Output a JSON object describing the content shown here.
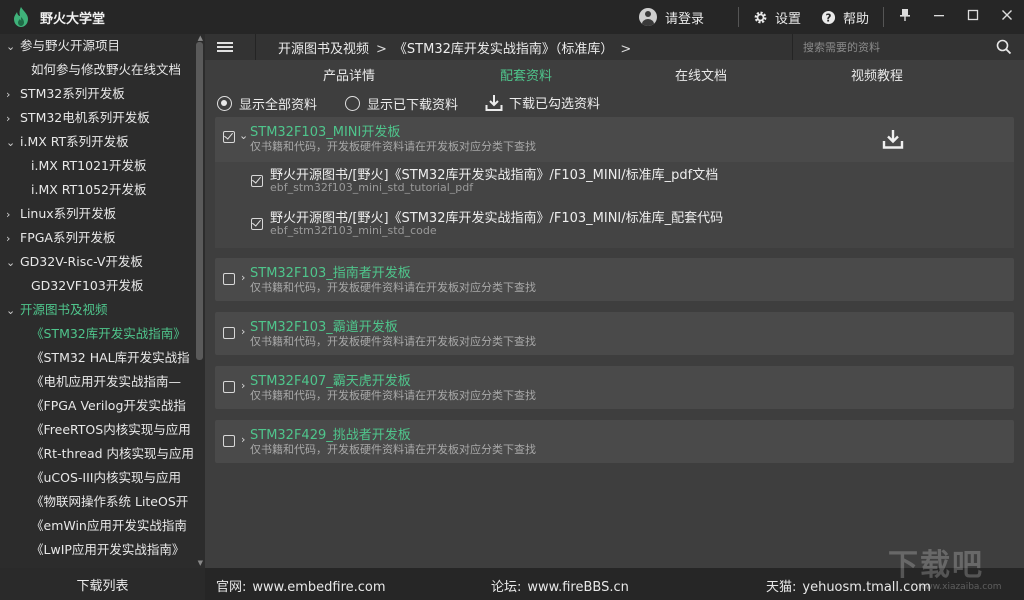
{
  "app": {
    "title": "野火大学堂",
    "login_label": "请登录",
    "settings_label": "设置",
    "help_label": "帮助"
  },
  "colors": {
    "accent": "#4fc58c",
    "titlebar": "#262626",
    "panel": "#4a4a4a"
  },
  "sidebar": {
    "items": [
      {
        "label": "参与野火开源项目",
        "level": 0,
        "arrow": "⌄"
      },
      {
        "label": "如何参与修改野火在线文档",
        "level": 1
      },
      {
        "label": "STM32系列开发板",
        "level": 0,
        "arrow": "›"
      },
      {
        "label": "STM32电机系列开发板",
        "level": 0,
        "arrow": "›"
      },
      {
        "label": "i.MX RT系列开发板",
        "level": 0,
        "arrow": "⌄"
      },
      {
        "label": "i.MX RT1021开发板",
        "level": 1
      },
      {
        "label": "i.MX RT1052开发板",
        "level": 1
      },
      {
        "label": "Linux系列开发板",
        "level": 0,
        "arrow": "›"
      },
      {
        "label": "FPGA系列开发板",
        "level": 0,
        "arrow": "›"
      },
      {
        "label": "GD32V-Risc-V开发板",
        "level": 0,
        "arrow": "⌄"
      },
      {
        "label": "GD32VF103开发板",
        "level": 1
      },
      {
        "label": "开源图书及视频",
        "level": 0,
        "arrow": "⌄",
        "active": true
      },
      {
        "label": "《STM32库开发实战指南》",
        "level": 1,
        "active": true
      },
      {
        "label": "《STM32 HAL库开发实战指",
        "level": 1
      },
      {
        "label": "《电机应用开发实战指南—",
        "level": 1
      },
      {
        "label": "《FPGA Verilog开发实战指",
        "level": 1
      },
      {
        "label": "《FreeRTOS内核实现与应用",
        "level": 1
      },
      {
        "label": "《Rt-thread 内核实现与应用",
        "level": 1
      },
      {
        "label": "《uCOS-III内核实现与应用",
        "level": 1
      },
      {
        "label": "《物联网操作系统 LiteOS开",
        "level": 1
      },
      {
        "label": "《emWin应用开发实战指南",
        "level": 1
      },
      {
        "label": "《LwIP应用开发实战指南》",
        "level": 1
      }
    ]
  },
  "breadcrumb": {
    "part1": "开源图书及视频",
    "part2": "《STM32库开发实战指南》（标准库）",
    "sep": ">"
  },
  "search": {
    "placeholder": "搜索需要的资料"
  },
  "tabs": [
    {
      "label": "产品详情",
      "active": false
    },
    {
      "label": "配套资料",
      "active": true
    },
    {
      "label": "在线文档",
      "active": false
    },
    {
      "label": "视频教程",
      "active": false
    }
  ],
  "filters": {
    "show_all": "显示全部资料",
    "show_downloaded": "显示已下载资料",
    "download_selected": "下载已勾选资料"
  },
  "boards": [
    {
      "title": "STM32F103_MINI开发板",
      "subtitle": "仅书籍和代码，开发板硬件资料请在开发板对应分类下查找",
      "checked": true,
      "expanded": true,
      "files": [
        {
          "title": "野火开源图书/[野火]《STM32库开发实战指南》/F103_MINI/标准库_pdf文档",
          "subtitle": "ebf_stm32f103_mini_std_tutorial_pdf",
          "checked": true
        },
        {
          "title": "野火开源图书/[野火]《STM32库开发实战指南》/F103_MINI/标准库_配套代码",
          "subtitle": "ebf_stm32f103_mini_std_code",
          "checked": true
        }
      ]
    },
    {
      "title": "STM32F103_指南者开发板",
      "subtitle": "仅书籍和代码，开发板硬件资料请在开发板对应分类下查找",
      "checked": false
    },
    {
      "title": "STM32F103_霸道开发板",
      "subtitle": "仅书籍和代码，开发板硬件资料请在开发板对应分类下查找",
      "checked": false
    },
    {
      "title": "STM32F407_霸天虎开发板",
      "subtitle": "仅书籍和代码，开发板硬件资料请在开发板对应分类下查找",
      "checked": false
    },
    {
      "title": "STM32F429_挑战者开发板",
      "subtitle": "仅书籍和代码，开发板硬件资料请在开发板对应分类下查找",
      "checked": false
    }
  ],
  "footer": {
    "download_list": "下载列表",
    "site_label": "官网:",
    "site_value": "www.embedfire.com",
    "forum_label": "论坛:",
    "forum_value": "www.fireBBS.cn",
    "tmall_label": "天猫:",
    "tmall_value": "yehuosm.tmall.com"
  },
  "watermark": {
    "text": "下载吧",
    "sub": "www.xiazaiba.com"
  }
}
